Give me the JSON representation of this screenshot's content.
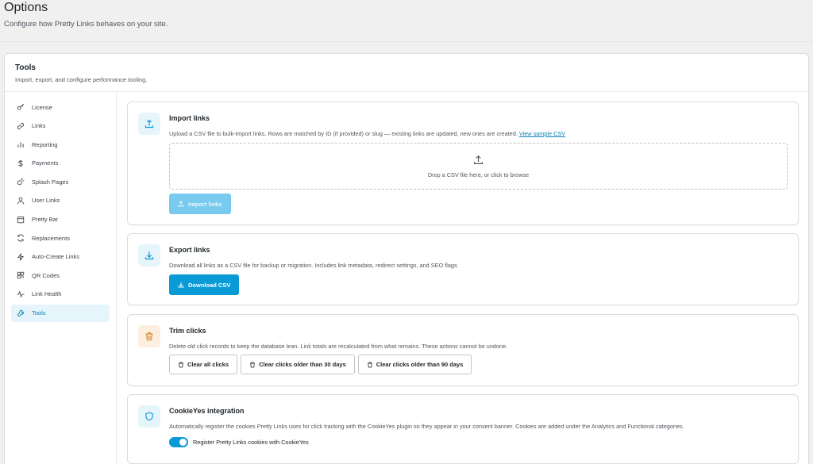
{
  "page": {
    "title": "Options",
    "subtitle": "Configure how Pretty Links behaves on your site."
  },
  "panel": {
    "title": "Tools",
    "subtitle": "Import, export, and configure performance tooling."
  },
  "sidebar": {
    "items": [
      {
        "label": "License",
        "icon": "key-icon"
      },
      {
        "label": "Links",
        "icon": "link-icon"
      },
      {
        "label": "Reporting",
        "icon": "bar-chart-icon"
      },
      {
        "label": "Payments",
        "icon": "dollar-icon"
      },
      {
        "label": "Splash Pages",
        "icon": "splash-icon"
      },
      {
        "label": "User Links",
        "icon": "user-icon"
      },
      {
        "label": "Pretty Bar",
        "icon": "window-icon"
      },
      {
        "label": "Replacements",
        "icon": "refresh-icon"
      },
      {
        "label": "Auto-Create Links",
        "icon": "lightning-icon"
      },
      {
        "label": "QR Codes",
        "icon": "qr-code-icon"
      },
      {
        "label": "Link Health",
        "icon": "pulse-icon"
      },
      {
        "label": "Tools",
        "icon": "wrench-icon",
        "active": true
      }
    ]
  },
  "import": {
    "title": "Import links",
    "description": "Upload a CSV file to bulk-import links. Rows are matched by ID (if provided) or slug — existing links are updated, new ones are created.",
    "sample_link": "View sample CSV",
    "dropzone_text": "Drop a CSV file here, or click to browse",
    "button_label": "Import links"
  },
  "export": {
    "title": "Export links",
    "description": "Download all links as a CSV file for backup or migration. Includes link metadata, redirect settings, and SEO flags.",
    "button_label": "Download CSV"
  },
  "trim": {
    "title": "Trim clicks",
    "description": "Delete old click records to keep the database lean. Link totals are recalculated from what remains. These actions cannot be undone.",
    "buttons": [
      "Clear all clicks",
      "Clear clicks older than 30 days",
      "Clear clicks older than 90 days"
    ]
  },
  "cookieyes": {
    "title": "CookieYes integration",
    "description": "Automatically register the cookies Pretty Links uses for click tracking with the CookieYes plugin so they appear in your consent banner. Cookies are added under the Analytics and Functional categories.",
    "toggle_label": "Register Pretty Links cookies with CookieYes",
    "toggle_on": true
  },
  "colors": {
    "accent": "#0a9ad6",
    "active_bg": "#e6f4fc",
    "warning_icon": "#d88b3d"
  }
}
